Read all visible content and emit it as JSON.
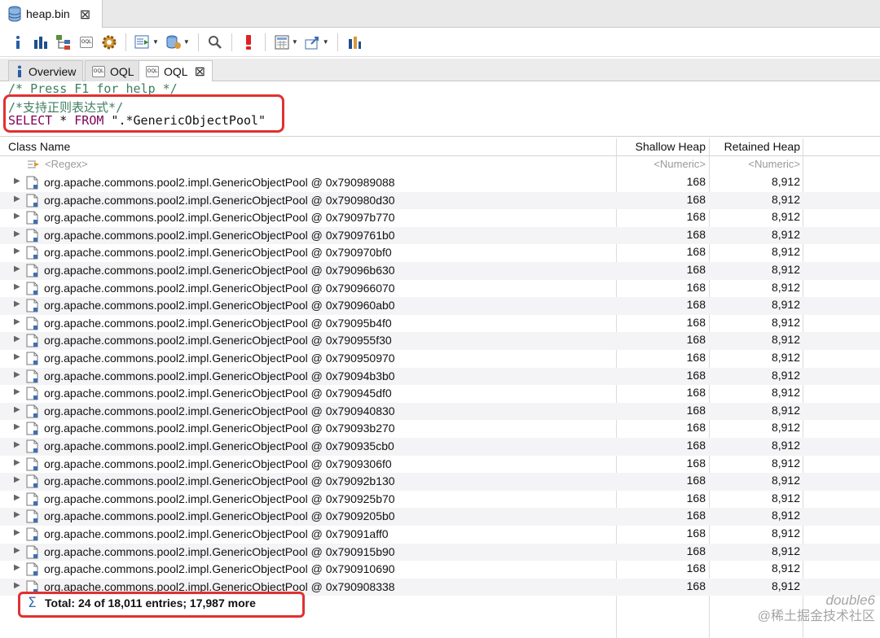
{
  "editor": {
    "file_tab": "heap.bin",
    "close_glyph": "⊠"
  },
  "toolbar": {
    "buttons": [
      {
        "name": "info-icon"
      },
      {
        "name": "histogram-icon"
      },
      {
        "name": "dominator-tree-icon"
      },
      {
        "name": "oql-icon"
      },
      {
        "name": "heap-dump-overview-icon"
      },
      {
        "name": "run-report-icon"
      },
      {
        "name": "query-browser-icon"
      },
      {
        "name": "search-icon"
      },
      {
        "name": "find-leaks-icon"
      },
      {
        "name": "calculate-retained-icon"
      },
      {
        "name": "export-icon"
      },
      {
        "name": "pin-icon"
      }
    ]
  },
  "tabs": {
    "overview": "Overview",
    "oql1": "OQL",
    "oql2": "OQL",
    "oql_badge": "OQL"
  },
  "query": {
    "help_comment": "/* Press F1 for help */",
    "regex_comment": "/*支持正则表达式*/",
    "kw_select": "SELECT",
    "star": " * ",
    "kw_from": "FROM",
    "pattern": " \".*GenericObjectPool\""
  },
  "table": {
    "headers": {
      "class_name": "Class Name",
      "shallow_heap": "Shallow Heap",
      "retained_heap": "Retained Heap"
    },
    "filter": {
      "regex": "<Regex>",
      "shallow": "<Numeric>",
      "retained": "<Numeric>"
    },
    "rows": [
      {
        "name": "org.apache.commons.pool2.impl.GenericObjectPool @ 0x790989088",
        "shallow": "168",
        "retained": "8,912"
      },
      {
        "name": "org.apache.commons.pool2.impl.GenericObjectPool @ 0x790980d30",
        "shallow": "168",
        "retained": "8,912"
      },
      {
        "name": "org.apache.commons.pool2.impl.GenericObjectPool @ 0x79097b770",
        "shallow": "168",
        "retained": "8,912"
      },
      {
        "name": "org.apache.commons.pool2.impl.GenericObjectPool @ 0x7909761b0",
        "shallow": "168",
        "retained": "8,912"
      },
      {
        "name": "org.apache.commons.pool2.impl.GenericObjectPool @ 0x790970bf0",
        "shallow": "168",
        "retained": "8,912"
      },
      {
        "name": "org.apache.commons.pool2.impl.GenericObjectPool @ 0x79096b630",
        "shallow": "168",
        "retained": "8,912"
      },
      {
        "name": "org.apache.commons.pool2.impl.GenericObjectPool @ 0x790966070",
        "shallow": "168",
        "retained": "8,912"
      },
      {
        "name": "org.apache.commons.pool2.impl.GenericObjectPool @ 0x790960ab0",
        "shallow": "168",
        "retained": "8,912"
      },
      {
        "name": "org.apache.commons.pool2.impl.GenericObjectPool @ 0x79095b4f0",
        "shallow": "168",
        "retained": "8,912"
      },
      {
        "name": "org.apache.commons.pool2.impl.GenericObjectPool @ 0x790955f30",
        "shallow": "168",
        "retained": "8,912"
      },
      {
        "name": "org.apache.commons.pool2.impl.GenericObjectPool @ 0x790950970",
        "shallow": "168",
        "retained": "8,912"
      },
      {
        "name": "org.apache.commons.pool2.impl.GenericObjectPool @ 0x79094b3b0",
        "shallow": "168",
        "retained": "8,912"
      },
      {
        "name": "org.apache.commons.pool2.impl.GenericObjectPool @ 0x790945df0",
        "shallow": "168",
        "retained": "8,912"
      },
      {
        "name": "org.apache.commons.pool2.impl.GenericObjectPool @ 0x790940830",
        "shallow": "168",
        "retained": "8,912"
      },
      {
        "name": "org.apache.commons.pool2.impl.GenericObjectPool @ 0x79093b270",
        "shallow": "168",
        "retained": "8,912"
      },
      {
        "name": "org.apache.commons.pool2.impl.GenericObjectPool @ 0x790935cb0",
        "shallow": "168",
        "retained": "8,912"
      },
      {
        "name": "org.apache.commons.pool2.impl.GenericObjectPool @ 0x7909306f0",
        "shallow": "168",
        "retained": "8,912"
      },
      {
        "name": "org.apache.commons.pool2.impl.GenericObjectPool @ 0x79092b130",
        "shallow": "168",
        "retained": "8,912"
      },
      {
        "name": "org.apache.commons.pool2.impl.GenericObjectPool @ 0x790925b70",
        "shallow": "168",
        "retained": "8,912"
      },
      {
        "name": "org.apache.commons.pool2.impl.GenericObjectPool @ 0x7909205b0",
        "shallow": "168",
        "retained": "8,912"
      },
      {
        "name": "org.apache.commons.pool2.impl.GenericObjectPool @ 0x79091aff0",
        "shallow": "168",
        "retained": "8,912"
      },
      {
        "name": "org.apache.commons.pool2.impl.GenericObjectPool @ 0x790915b90",
        "shallow": "168",
        "retained": "8,912"
      },
      {
        "name": "org.apache.commons.pool2.impl.GenericObjectPool @ 0x790910690",
        "shallow": "168",
        "retained": "8,912"
      },
      {
        "name": "org.apache.commons.pool2.impl.GenericObjectPool @ 0x790908338",
        "shallow": "168",
        "retained": "8,912"
      }
    ],
    "total": "Total: 24 of 18,011 entries; 17,987 more"
  },
  "watermark": {
    "line1": "double6",
    "line2": "@稀土掘金技术社区"
  },
  "colors": {
    "highlight": "#e03131",
    "comment": "#3f7f5f",
    "keyword": "#7f0055",
    "string": "#2a00ff"
  }
}
